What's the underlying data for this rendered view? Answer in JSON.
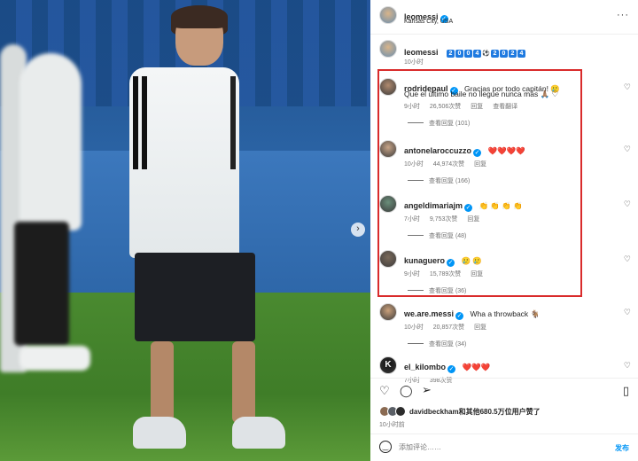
{
  "post": {
    "author": "leomessi",
    "location": "Kansas City, USA",
    "caption_author": "leomessi",
    "caption_badges": [
      "2",
      "0",
      "0",
      "4",
      "⚽",
      "2",
      "0",
      "2",
      "4"
    ],
    "caption_time": "10小时"
  },
  "comments": [
    {
      "user": "rodridepaul",
      "text": "Gracias por todo capitán! 🥲",
      "text2": "Que el último baile no llegue nunca más 🙏🏽 ♡",
      "time": "9小时",
      "likes": "26,506次赞",
      "reply": "回复",
      "translate": "查看翻译",
      "view_replies": "查看回复 (101)"
    },
    {
      "user": "antonelaroccuzzo",
      "text": "❤️❤️❤️❤️",
      "time": "10小时",
      "likes": "44,974次赞",
      "reply": "回复",
      "view_replies": "查看回复 (166)"
    },
    {
      "user": "angeldimariajm",
      "text": "👏 👏 👏 👏",
      "time": "7小时",
      "likes": "9,753次赞",
      "reply": "回复",
      "view_replies": "查看回复 (48)"
    },
    {
      "user": "kunaguero",
      "text": "🥲 🥲",
      "time": "9小时",
      "likes": "15,789次赞",
      "reply": "回复",
      "view_replies": "查看回复 (36)"
    },
    {
      "user": "we.are.messi",
      "text": "Wha a throwback 🐐",
      "time": "10小时",
      "likes": "20,857次赞",
      "reply": "回复",
      "view_replies": "查看回复 (34)"
    },
    {
      "user": "el_kilombo",
      "text": "❤️❤️❤️",
      "time": "7小时",
      "likes": "398次赞",
      "reply": "",
      "view_replies": ""
    }
  ],
  "likes_line": {
    "first": "davidbeckham",
    "rest": "和其他680.5万位用户赞了"
  },
  "post_time": "10小时前",
  "comment_box": {
    "placeholder": "添加评论……",
    "submit": "发布"
  },
  "icons": {
    "heart": "heart-icon",
    "comment": "comment-icon",
    "share": "share-icon",
    "save": "bookmark-icon",
    "next": "chevron-right-icon"
  },
  "colors": {
    "highlight": "#d92b2b",
    "verified": "#0095f6",
    "submit": "#0095f6"
  }
}
